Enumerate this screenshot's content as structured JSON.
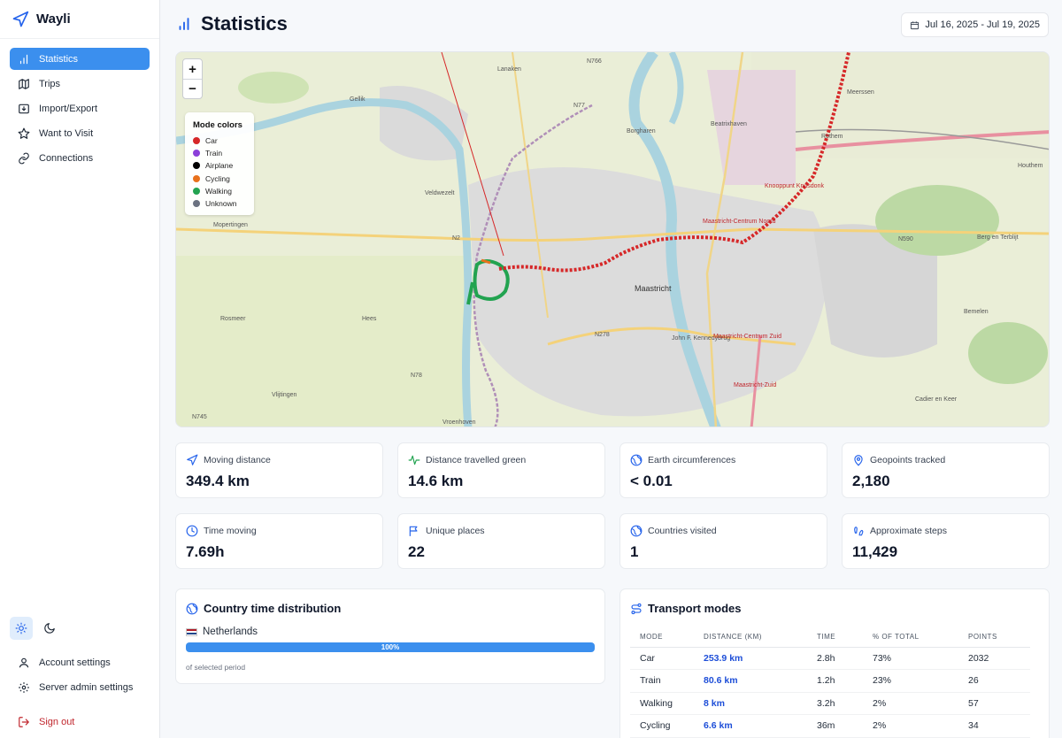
{
  "app": {
    "name": "Wayli"
  },
  "sidebar": {
    "items": [
      {
        "label": "Statistics",
        "icon": "bar-chart-icon",
        "active": true
      },
      {
        "label": "Trips",
        "icon": "map-icon"
      },
      {
        "label": "Import/Export",
        "icon": "import-icon"
      },
      {
        "label": "Want to Visit",
        "icon": "star-icon"
      },
      {
        "label": "Connections",
        "icon": "link-icon"
      }
    ],
    "bottom": {
      "account": "Account settings",
      "admin": "Server admin settings",
      "signout": "Sign out"
    }
  },
  "header": {
    "title": "Statistics",
    "date_range": "Jul 16, 2025 - Jul 19, 2025"
  },
  "map": {
    "zoom_in": "+",
    "zoom_out": "−",
    "legend_title": "Mode colors",
    "modes": [
      {
        "label": "Car",
        "color": "#d62728"
      },
      {
        "label": "Train",
        "color": "#8b3fd9"
      },
      {
        "label": "Airplane",
        "color": "#000000"
      },
      {
        "label": "Cycling",
        "color": "#e8711c"
      },
      {
        "label": "Walking",
        "color": "#22a350"
      },
      {
        "label": "Unknown",
        "color": "#6b7280"
      }
    ],
    "places": {
      "lanaken": "Lanaken",
      "gellik": "Gellik",
      "veldwezelt": "Veldwezelt",
      "mopertingen": "Mopertingen",
      "rosmeer": "Rosmeer",
      "hees": "Hees",
      "vlijtingen": "Vlijtingen",
      "vroenhoven": "Vroenhoven",
      "maastricht": "Maastricht",
      "borgharen": "Borgharen",
      "beatrixhaven": "Beatrixhaven",
      "meerssen": "Meerssen",
      "rothem": "Rothem",
      "houthem": "Houthem",
      "berg": "Berg en Terblijt",
      "bemelen": "Bemelen",
      "cadier": "Cadier en Keer",
      "kennedybrug": "John F. Kennedybrug",
      "n2": "N2",
      "n77": "N77",
      "n766": "N766",
      "n278": "N278",
      "n78": "N78",
      "n745": "N745",
      "n590": "N590",
      "mcn": "Maastricht-Centrum Noord",
      "mcz": "Maastricht-Centrum Zuid",
      "mz": "Maastricht-Zuid",
      "kruisdonk": "Knooppunt Kruisdonk"
    }
  },
  "stats": [
    {
      "label": "Moving distance",
      "value": "349.4 km",
      "icon": "navigation-icon"
    },
    {
      "label": "Distance travelled green",
      "value": "14.6 km",
      "icon": "activity-icon"
    },
    {
      "label": "Earth circumferences",
      "value": "< 0.01",
      "icon": "globe-icon"
    },
    {
      "label": "Geopoints tracked",
      "value": "2,180",
      "icon": "map-pin-icon"
    },
    {
      "label": "Time moving",
      "value": "7.69h",
      "icon": "clock-icon"
    },
    {
      "label": "Unique places",
      "value": "22",
      "icon": "flag-icon"
    },
    {
      "label": "Countries visited",
      "value": "1",
      "icon": "globe-icon"
    },
    {
      "label": "Approximate steps",
      "value": "11,429",
      "icon": "footprints-icon"
    }
  ],
  "country_distribution": {
    "title": "Country time distribution",
    "countries": [
      {
        "name": "Netherlands",
        "percent_label": "100%",
        "fraction": 1.0
      }
    ],
    "footnote": "of selected period"
  },
  "transport": {
    "title": "Transport modes",
    "columns": [
      "MODE",
      "DISTANCE (KM)",
      "TIME",
      "% OF TOTAL",
      "POINTS"
    ],
    "rows": [
      [
        "Car",
        "253.9 km",
        "2.8h",
        "73%",
        "2032"
      ],
      [
        "Train",
        "80.6 km",
        "1.2h",
        "23%",
        "26"
      ],
      [
        "Walking",
        "8 km",
        "3.2h",
        "2%",
        "57"
      ],
      [
        "Cycling",
        "6.6 km",
        "36m",
        "2%",
        "34"
      ]
    ]
  },
  "colors": {
    "accent": "#3b8fee",
    "signout": "#c0262d",
    "distance_link": "#1d4ed8"
  }
}
